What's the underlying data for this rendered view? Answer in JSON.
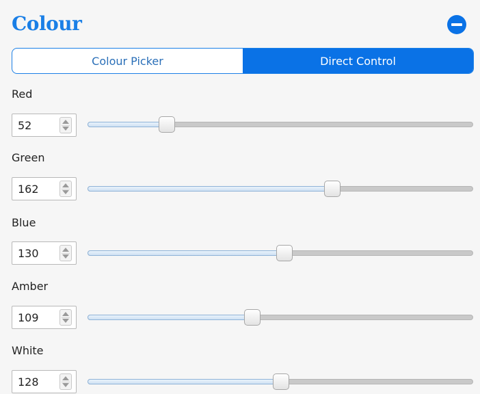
{
  "header": {
    "title": "Colour"
  },
  "tabs": [
    {
      "label": "Colour Picker",
      "active": false
    },
    {
      "label": "Direct Control",
      "active": true
    }
  ],
  "channels": [
    {
      "label": "Red",
      "value": "52",
      "fraction": 0.204
    },
    {
      "label": "Green",
      "value": "162",
      "fraction": 0.635
    },
    {
      "label": "Blue",
      "value": "130",
      "fraction": 0.51
    },
    {
      "label": "Amber",
      "value": "109",
      "fraction": 0.427
    },
    {
      "label": "White",
      "value": "128",
      "fraction": 0.502
    }
  ],
  "colors": {
    "accent": "#0a72e6",
    "title": "#1a7fe6"
  }
}
